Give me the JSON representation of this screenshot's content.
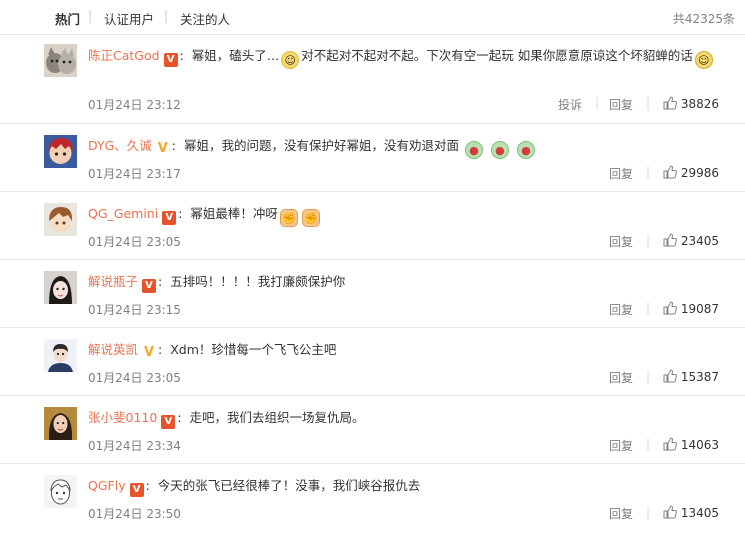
{
  "tabs": [
    {
      "label": "热门",
      "active": true
    },
    {
      "label": "认证用户",
      "active": false
    },
    {
      "label": "关注的人",
      "active": false
    }
  ],
  "total": "共42325条",
  "actions": {
    "report": "投诉",
    "reply": "回复",
    "separator": "|"
  },
  "comments": [
    {
      "user": "陈正CatGod",
      "badge": "red",
      "text_a": "幂姐，磕头了…",
      "text_b": "对不起对不起对不起。下次有空一起玩 如果你愿意原谅这个坏貂蝉的话",
      "time": "01月24日 23:12",
      "likes": "38826",
      "has_report": true
    },
    {
      "user": "DYG、久诚",
      "badge": "gold",
      "text_a": "幂姐，我的问题，没有保护好幂姐，没有劝退对面",
      "text_b": "",
      "time": "01月24日 23:17",
      "likes": "29986",
      "has_report": false
    },
    {
      "user": "QG_Gemini",
      "badge": "red",
      "text_a": "幂姐最棒！冲呀",
      "text_b": "",
      "time": "01月24日 23:05",
      "likes": "23405",
      "has_report": false
    },
    {
      "user": "解说瓶子",
      "badge": "red",
      "text_a": "五排吗！！！！我打廉颇保护你",
      "text_b": "",
      "time": "01月24日 23:15",
      "likes": "19087",
      "has_report": false
    },
    {
      "user": "解说英凯",
      "badge": "gold",
      "text_a": "Xdm！珍惜每一个飞飞公主吧",
      "text_b": "",
      "time": "01月24日 23:05",
      "likes": "15387",
      "has_report": false
    },
    {
      "user": "张小斐0110",
      "badge": "red",
      "text_a": "走吧，我们去组织一场复仇局。",
      "text_b": "",
      "time": "01月24日 23:34",
      "likes": "14063",
      "has_report": false
    },
    {
      "user": "QGFly",
      "badge": "red",
      "text_a": "今天的张飞已经很棒了！没事，我们峡谷报仇去",
      "text_b": "",
      "time": "01月24日 23:50",
      "likes": "13405",
      "has_report": false
    }
  ]
}
